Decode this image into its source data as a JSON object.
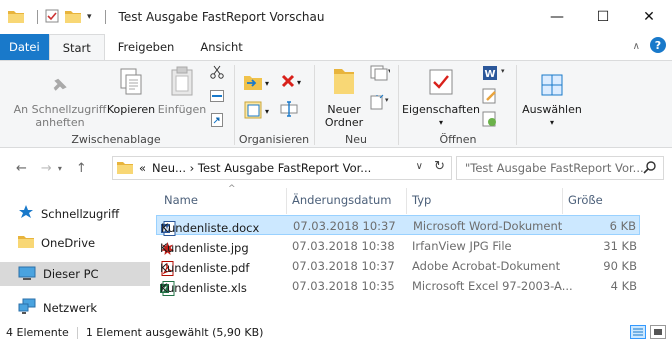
{
  "window": {
    "title": "Test Ausgabe FastReport Vorschau",
    "minimize": "—",
    "maximize": "☐",
    "close": "✕"
  },
  "tabs": [
    {
      "label": "Datei"
    },
    {
      "label": "Start"
    },
    {
      "label": "Freigeben"
    },
    {
      "label": "Ansicht"
    }
  ],
  "ribbon": {
    "clipboard": {
      "pin_label": "An Schnellzugriff anheften",
      "copy_label": "Kopieren",
      "paste_label": "Einfügen",
      "group_label": "Zwischenablage"
    },
    "organize": {
      "group_label": "Organisieren"
    },
    "new": {
      "new_folder_label": "Neuer Ordner",
      "group_label": "Neu"
    },
    "open": {
      "properties_label": "Eigenschaften",
      "group_label": "Öffnen"
    },
    "select": {
      "select_label": "Auswählen"
    }
  },
  "address": {
    "prefix": "«",
    "path": "Neu... › Test Ausgabe FastReport Vor...",
    "search_placeholder": "\"Test Ausgabe FastReport Vor..."
  },
  "sidebar": {
    "items": [
      {
        "label": "Schnellzugriff",
        "icon": "star-icon"
      },
      {
        "label": "OneDrive",
        "icon": "folder-icon"
      },
      {
        "label": "Dieser PC",
        "icon": "computer-icon"
      },
      {
        "label": "Netzwerk",
        "icon": "network-icon"
      }
    ]
  },
  "columns": {
    "name": "Name",
    "date": "Änderungsdatum",
    "type": "Typ",
    "size": "Größe"
  },
  "files": [
    {
      "name": "Kundenliste.docx",
      "date": "07.03.2018 10:37",
      "type": "Microsoft Word-Dokument",
      "size": "6 KB",
      "icon": "word-file-icon",
      "selected": true
    },
    {
      "name": "Kundenliste.jpg",
      "date": "07.03.2018 10:38",
      "type": "IrfanView JPG File",
      "size": "31 KB",
      "icon": "irfanview-file-icon",
      "selected": false
    },
    {
      "name": "Kundenliste.pdf",
      "date": "07.03.2018 10:37",
      "type": "Adobe Acrobat-Dokument",
      "size": "90 KB",
      "icon": "pdf-file-icon",
      "selected": false
    },
    {
      "name": "Kundenliste.xls",
      "date": "07.03.2018 10:35",
      "type": "Microsoft Excel 97-2003-A...",
      "size": "4 KB",
      "icon": "excel-file-icon",
      "selected": false
    }
  ],
  "status": {
    "count": "4 Elemente",
    "selection": "1 Element ausgewählt (5,90 KB)"
  },
  "colors": {
    "accent": "#1979ca",
    "selection": "#cce8ff"
  }
}
